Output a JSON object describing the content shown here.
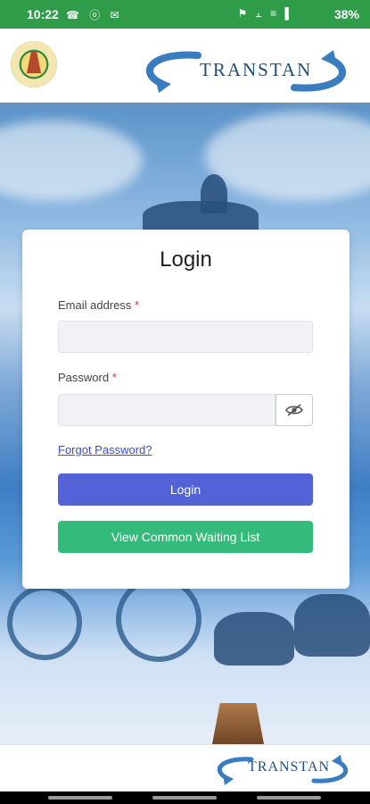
{
  "status_bar": {
    "time": "10:22",
    "left_icons": "☎ ⓞ ✉",
    "right_icons": "⚑ ⫠ ≡ ▌",
    "battery": "38%"
  },
  "header": {
    "logo_name": "tamil-nadu-emblem",
    "brand": "TRANSTAN"
  },
  "login_card": {
    "title": "Login",
    "email_label": "Email address",
    "email_value": "",
    "email_placeholder": "",
    "password_label": "Password",
    "password_value": "",
    "password_placeholder": "",
    "required_marker": "*",
    "toggle_icon": "eye-off-icon",
    "forgot_link": "Forgot Password?",
    "login_button": "Login",
    "waiting_list_button": "View Common Waiting List"
  },
  "footer": {
    "brand": "TRANSTAN"
  },
  "colors": {
    "status_bar": "#2e9c48",
    "primary_button": "#5462d8",
    "secondary_button": "#34ba7a",
    "link": "#3c4bcf",
    "required": "#d9363e"
  }
}
